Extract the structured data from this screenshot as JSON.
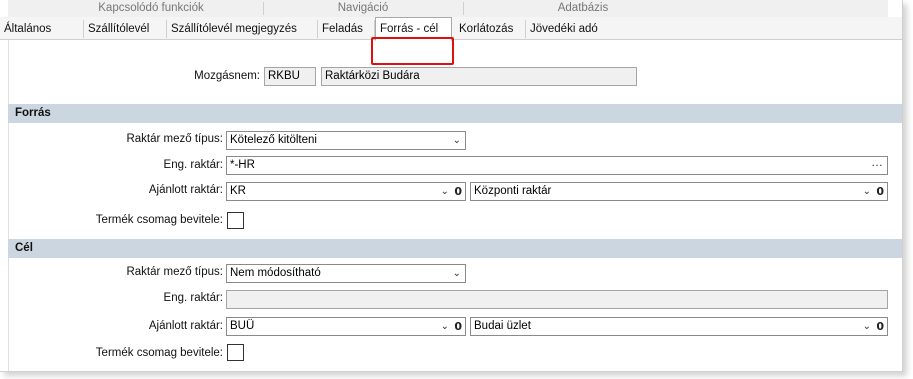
{
  "ribbon": {
    "groups": [
      "Kapcsolódó funkciók",
      "Navigáció",
      "Adatbázis"
    ]
  },
  "tabs": [
    {
      "label": "Általános"
    },
    {
      "label": "Szállítólevél"
    },
    {
      "label": "Szállítólevél megjegyzés"
    },
    {
      "label": "Feladás"
    },
    {
      "label": "Forrás - cél",
      "active": true
    },
    {
      "label": "Korlátozás"
    },
    {
      "label": "Jövedéki adó"
    }
  ],
  "header": {
    "mozgasnem_label": "Mozgásnem:",
    "mozgasnem_code": "RKBU",
    "mozgasnem_name": "Raktárközi Budára"
  },
  "forras": {
    "title": "Forrás",
    "raktar_tipus_label": "Raktár mező típus:",
    "raktar_tipus_value": "Kötelező kitölteni",
    "eng_raktar_label": "Eng. raktár:",
    "eng_raktar_value": "*-HR",
    "ajanlott_label": "Ajánlott raktár:",
    "ajanlott_code": "KR",
    "ajanlott_name": "Központi raktár",
    "termek_label": "Termék csomag bevitele:"
  },
  "cel": {
    "title": "Cél",
    "raktar_tipus_label": "Raktár mező típus:",
    "raktar_tipus_value": "Nem módosítható",
    "eng_raktar_label": "Eng. raktár:",
    "eng_raktar_value": "",
    "ajanlott_label": "Ajánlott raktár:",
    "ajanlott_code": "BUÜ",
    "ajanlott_name": "Budai üzlet",
    "termek_label": "Termék csomag bevitele:"
  },
  "icons": {
    "dropdown": "chevron-down-icon",
    "attach": "paperclip-icon",
    "more": "ellipsis-icon"
  },
  "colors": {
    "section_bar": "#ccd6e0",
    "highlight": "#e01010"
  }
}
